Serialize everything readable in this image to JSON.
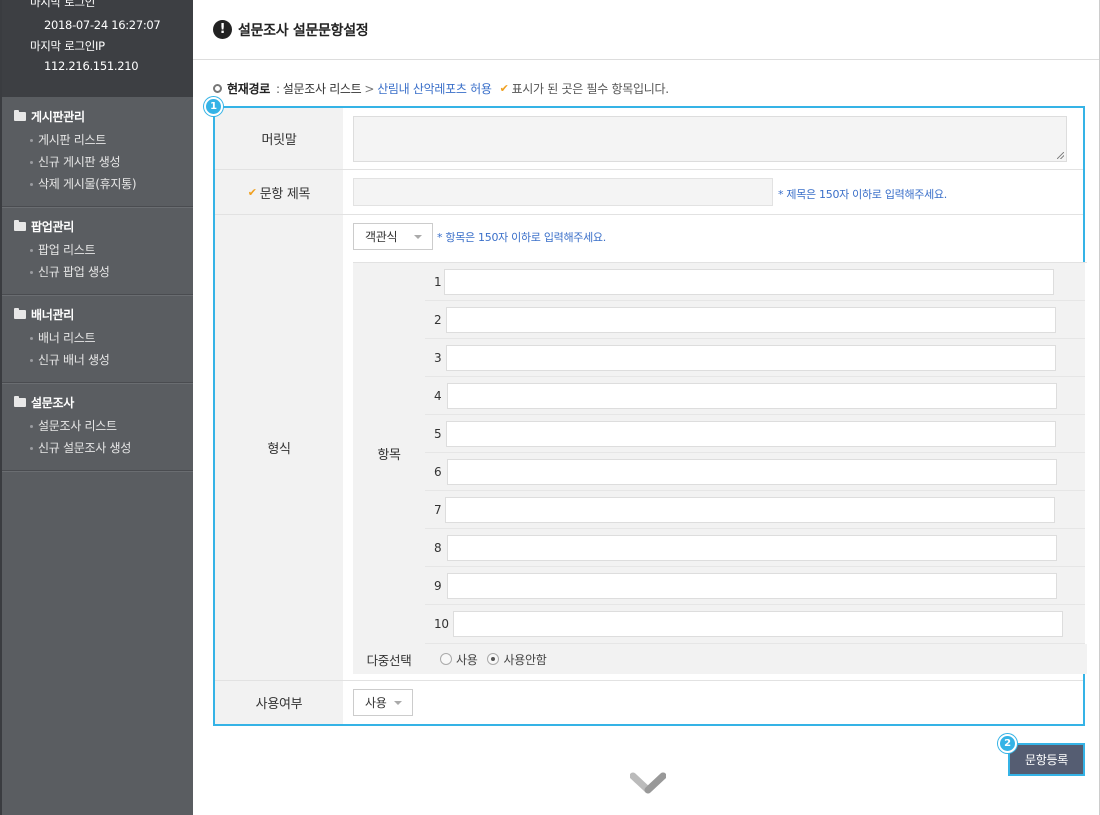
{
  "sidebar": {
    "last_login_label": "마지막 로그인",
    "last_login_value": "2018-07-24 16:27:07",
    "last_ip_label": "마지막 로그인IP",
    "last_ip_value": "112.216.151.210",
    "groups": [
      {
        "title": "게시판관리",
        "items": [
          "게시판 리스트",
          "신규 게시판 생성",
          "삭제 게시물(휴지통)"
        ]
      },
      {
        "title": "팝업관리",
        "items": [
          "팝업 리스트",
          "신규 팝업 생성"
        ]
      },
      {
        "title": "배너관리",
        "items": [
          "배너 리스트",
          "신규 배너 생성"
        ]
      },
      {
        "title": "설문조사",
        "items": [
          "설문조사 리스트",
          "신규 설문조사 생성"
        ]
      }
    ]
  },
  "header": {
    "icon": "!",
    "title": "설문조사 설문문항설정"
  },
  "breadcrumb": {
    "home": "현재경로",
    "sep": ":",
    "link": "설문조사 리스트",
    "arrow": ">",
    "current": "산림내 산악레포츠 허용",
    "note": "표시가 된 곳은 필수 항목입니다."
  },
  "form": {
    "badge1": "1",
    "prefix_label": "머릿말",
    "title_label": "문항 제목",
    "title_hint": "* 제목은 150자 이하로 입력해주세요.",
    "format_label": "형식",
    "format_select": "객관식",
    "format_hint": "* 항목은 150자 이하로 입력해주세요.",
    "items_label": "항목",
    "item_numbers": [
      "1",
      "2",
      "3",
      "4",
      "5",
      "6",
      "7",
      "8",
      "9",
      "10"
    ],
    "multi_label": "다중선택",
    "multi_options": [
      "사용",
      "사용안함"
    ],
    "multi_selected": "사용안함",
    "usage_label": "사용여부",
    "usage_select": "사용"
  },
  "actions": {
    "badge2": "2",
    "submit_label": "문항등록"
  },
  "colors": {
    "accent": "#35b3e6",
    "sidebar": "#5a5d61",
    "button": "#555d72",
    "link": "#3a6fc9",
    "check": "#f0a020"
  }
}
